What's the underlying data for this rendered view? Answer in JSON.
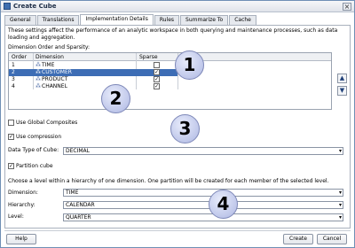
{
  "window": {
    "title": "Create Cube",
    "close_glyph": "×"
  },
  "tabs": [
    {
      "label": "General"
    },
    {
      "label": "Translations"
    },
    {
      "label": "Implementation Details"
    },
    {
      "label": "Rules"
    },
    {
      "label": "Summarize To"
    },
    {
      "label": "Cache"
    }
  ],
  "active_tab": "Implementation Details",
  "description": "These settings affect the performance of an analytic workspace in both querying and maintenance processes, such as data loading and aggregation.",
  "dimension_section": {
    "label": "Dimension Order and Sparsity:",
    "columns": {
      "order": "Order",
      "dimension": "Dimension",
      "sparse": "Sparse"
    },
    "rows": [
      {
        "order": "1",
        "dimension": "TIME",
        "sparse": false
      },
      {
        "order": "2",
        "dimension": "CUSTOMER",
        "sparse": true,
        "selected": true
      },
      {
        "order": "3",
        "dimension": "PRODUCT",
        "sparse": true
      },
      {
        "order": "4",
        "dimension": "CHANNEL",
        "sparse": true
      }
    ],
    "move_up_glyph": "▲",
    "move_down_glyph": "▼"
  },
  "options": {
    "global_composites": {
      "label": "Use Global Composites",
      "checked": false
    },
    "compression": {
      "label": "Use compression",
      "checked": true
    },
    "data_type_label": "Data Type of Cube:",
    "data_type_value": "DECIMAL",
    "partition": {
      "label": "Partition cube",
      "checked": true
    },
    "partition_note": "Choose a level within a hierarchy of one dimension. One partition will be created for each member of the selected level.",
    "dimension_label": "Dimension:",
    "dimension_value": "TIME",
    "hierarchy_label": "Hierarchy:",
    "hierarchy_value": "CALENDAR",
    "level_label": "Level:",
    "level_value": "QUARTER"
  },
  "buttons": {
    "help": "Help",
    "create": "Create",
    "cancel": "Cancel"
  },
  "callouts": [
    "1",
    "2",
    "3",
    "4"
  ],
  "icons": {
    "checked": "✓",
    "dimension": "⁂",
    "select_arrow": "▾"
  },
  "colors": {
    "selection": "#3d6db5",
    "callout_fill": "#bfc7ea"
  }
}
